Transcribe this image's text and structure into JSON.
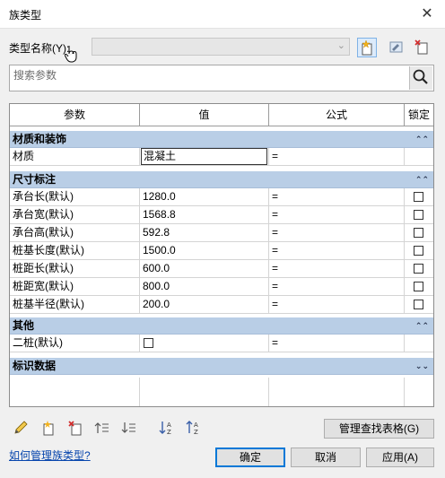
{
  "window": {
    "title": "族类型",
    "close_glyph": "✕"
  },
  "type_row": {
    "label": "类型名称(Y):",
    "selected_value": ""
  },
  "search": {
    "placeholder": "搜索参数"
  },
  "table": {
    "headers": {
      "param": "参数",
      "value": "值",
      "formula": "公式",
      "lock": "锁定"
    },
    "sections": [
      {
        "name": "材质和装饰",
        "collapse": "⌃⌃",
        "rows": [
          {
            "param": "材质",
            "value": "混凝土",
            "formula": "="
          }
        ]
      },
      {
        "name": "尺寸标注",
        "collapse": "⌃⌃",
        "rows": [
          {
            "param": "承台长(默认)",
            "value": "1280.0",
            "formula": "="
          },
          {
            "param": "承台宽(默认)",
            "value": "1568.8",
            "formula": "="
          },
          {
            "param": "承台高(默认)",
            "value": "592.8",
            "formula": "="
          },
          {
            "param": "桩基长度(默认)",
            "value": "1500.0",
            "formula": "="
          },
          {
            "param": "桩距长(默认)",
            "value": "600.0",
            "formula": "="
          },
          {
            "param": "桩距宽(默认)",
            "value": "800.0",
            "formula": "="
          },
          {
            "param": "桩基半径(默认)",
            "value": "200.0",
            "formula": "="
          }
        ]
      },
      {
        "name": "其他",
        "collapse": "⌃⌃",
        "rows": [
          {
            "param": "二桩(默认)",
            "value": "",
            "formula": "="
          }
        ]
      },
      {
        "name": "标识数据",
        "collapse": "⌄⌄",
        "rows": []
      }
    ]
  },
  "buttons": {
    "manage_lookup": "管理查找表格(G)",
    "ok": "确定",
    "cancel": "取消",
    "apply": "应用(A)"
  },
  "help_link": "如何管理族类型?"
}
